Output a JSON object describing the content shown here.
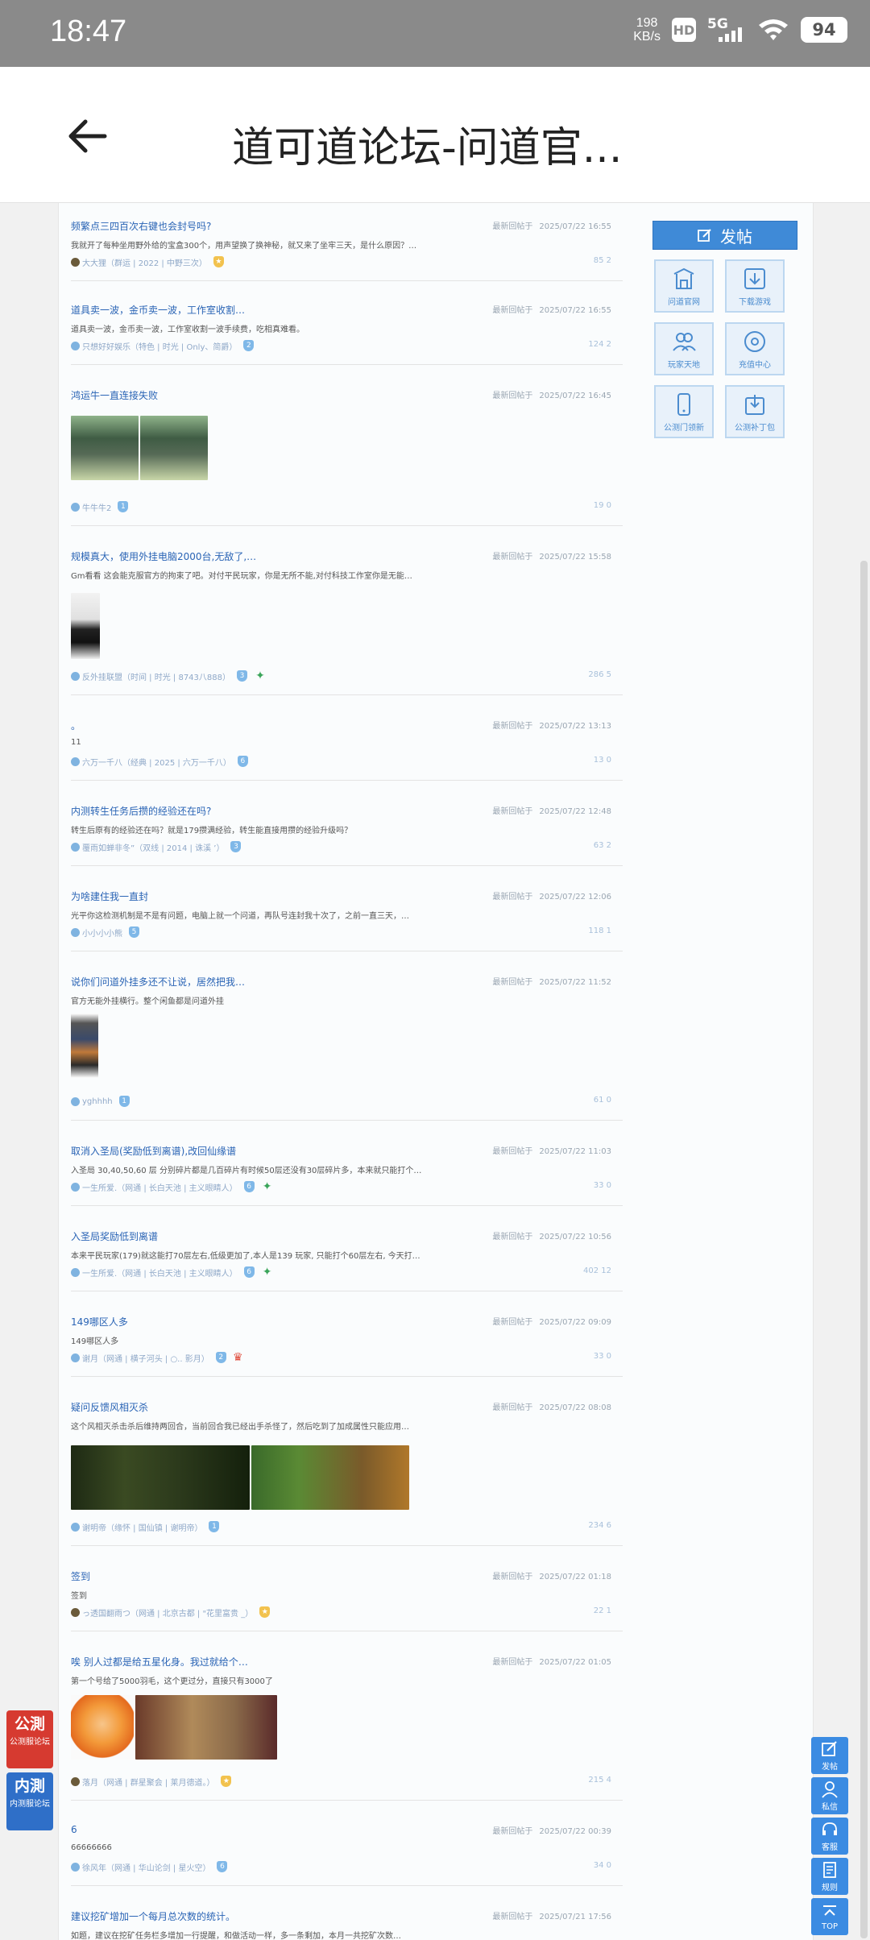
{
  "status_bar": {
    "time": "18:47",
    "net_speed_value": "198",
    "net_speed_unit": "KB/s",
    "hd_label": "HD",
    "network_label": "5G",
    "battery_level": "94"
  },
  "app_bar": {
    "title": "道可道论坛-问道官..."
  },
  "side_panel": {
    "post_button": "发帖",
    "links": [
      "问道官网",
      "下载游戏",
      "玩家天地",
      "充值中心",
      "公测门领新",
      "公测补丁包"
    ]
  },
  "posts": [
    {
      "title": "频繁点三四百次右键也会封号吗?",
      "reply_label": "最新回帖于",
      "date": "2025/07/22 16:55",
      "excerpt": "我就开了每种坐用野外给的宝盒300个，用声望换了换神秘，就又来了坐牢三天，是什么原因？…",
      "author": "大大狸",
      "info": "（群运 | 2022 | 中野三次）",
      "stats": "85 2"
    },
    {
      "title": "道具卖一波，金币卖一波，工作室收割…",
      "reply_label": "最新回帖于",
      "date": "2025/07/22 16:55",
      "excerpt": "道具卖一波，金币卖一波，工作室收割一波手续费，吃相真难看。",
      "author": "只想好好娱乐",
      "info": "（特色 | 时光 | Only、简爵）",
      "stats": "124 2"
    },
    {
      "title": "鸿运牛一直连接失败",
      "reply_label": "最新回帖于",
      "date": "2025/07/22 16:45",
      "excerpt": "",
      "author": "牛牛牛2",
      "info": "",
      "stats": "19 0"
    },
    {
      "title": "规模真大，使用外挂电脑2000台,无敌了,…",
      "reply_label": "最新回帖于",
      "date": "2025/07/22 15:58",
      "excerpt": "Gm看看 这会能克服官方的拘束了吧。对付平民玩家，你是无所不能,对付科技工作室你是无能…",
      "author": "反外挂联盟",
      "info": "（时间 | 时光 | 8743八888）",
      "stats": "286 5"
    },
    {
      "title": "。",
      "reply_label": "最新回帖于",
      "date": "2025/07/22 13:13",
      "excerpt": "11",
      "author": "六万一千八",
      "info": "（经典 | 2025 | 六万一千八）",
      "stats": "13 0"
    },
    {
      "title": "内测转生任务后攒的经验还在吗?",
      "reply_label": "最新回帖于",
      "date": "2025/07/22 12:48",
      "excerpt": "转生后原有的经验还在吗？就是179攒满经验，转生能直接用攒的经验升级吗？",
      "author": "覆雨如蝉非冬”",
      "info": "（双线 | 2014 | 诛溪 ’）",
      "stats": "63 2"
    },
    {
      "title": "为啥建住我一直封",
      "reply_label": "最新回帖于",
      "date": "2025/07/22 12:06",
      "excerpt": "光平你这检测机制是不是有问题，电脑上就一个问道，再队号连封我十次了，之前一直三天，…",
      "author": "小小小小熊",
      "info": "",
      "stats": "118 1"
    },
    {
      "title": "说你们问道外挂多还不让说，居然把我…",
      "reply_label": "最新回帖于",
      "date": "2025/07/22 11:52",
      "excerpt": "官方无能外挂横行。整个闲鱼都是问道外挂",
      "author": "yghhhh",
      "info": "",
      "stats": "61 0"
    },
    {
      "title": "取消入圣局(奖励低到离谱),改回仙缘谱",
      "reply_label": "最新回帖于",
      "date": "2025/07/22 11:03",
      "excerpt": "入圣局 30,40,50,60 层 分别碎片都是几百碎片有时候50层还没有30层碎片多，本来就只能打个…",
      "author": "一生所爱.",
      "info": "（网通 | 长白天池 | 主义眼睛人）",
      "stats": "33 0"
    },
    {
      "title": "入圣局奖励低到离谱",
      "reply_label": "最新回帖于",
      "date": "2025/07/22 10:56",
      "excerpt": "本来平民玩家(179)就这能打70层左右,低级更加了,本人是139 玩家, 只能打个60层左右, 今天打…",
      "author": "一生所爱.",
      "info": "（网通 | 长白天池 | 主义眼睛人）",
      "stats": "402 12"
    },
    {
      "title": "149哪区人多",
      "reply_label": "最新回帖于",
      "date": "2025/07/22 09:09",
      "excerpt": "149哪区人多",
      "author": "谢月",
      "info": "（网通 | 横子河头 | ○.. 影月）",
      "stats": "33 0"
    },
    {
      "title": "疑问反馈风相灭杀",
      "reply_label": "最新回帖于",
      "date": "2025/07/22 08:08",
      "excerpt": "这个风相灭杀击杀后维持两回合，当前回合我已经出手杀怪了，然后吃到了加成属性只能应用…",
      "author": "谢明帝",
      "info": "（缘怀 | 国仙镇 | 谢明帝）",
      "stats": "234 6"
    },
    {
      "title": "签到",
      "reply_label": "最新回帖于",
      "date": "2025/07/22 01:18",
      "excerpt": "签到",
      "author": "っ透国翻雨つ",
      "info": "（网通 | 北京古都 | \"花里富贵 _）",
      "stats": "22 1"
    },
    {
      "title": "唉 别人过都是给五星化身。我过就给个…",
      "reply_label": "最新回帖于",
      "date": "2025/07/22 01:05",
      "excerpt": "第一个号给了5000羽毛，这个更过分，直接只有3000了",
      "author": "落月",
      "info": "（网通 | 群星聚会 | 莱月德道。）",
      "stats": "215 4"
    },
    {
      "title": "6",
      "reply_label": "最新回帖于",
      "date": "2025/07/22 00:39",
      "excerpt": "66666666",
      "author": "徐风年",
      "info": "（网通 | 华山论剑 | 星火空）",
      "stats": "34 0"
    },
    {
      "title": "建议挖矿增加一个每月总次数的统计。",
      "reply_label": "最新回帖于",
      "date": "2025/07/21 17:56",
      "excerpt": "如题，建议在挖矿任务栏多增加一行提醒，和做活动一样，多一条剩加，本月一共挖矿次数…",
      "author": "",
      "info": "",
      "stats": ""
    }
  ],
  "float_left": [
    {
      "logo": "公測",
      "label": "公测服论坛"
    },
    {
      "logo": "内測",
      "label": "内测服论坛"
    }
  ],
  "float_right": [
    "发帖",
    "私信",
    "客服",
    "规则",
    "TOP"
  ]
}
